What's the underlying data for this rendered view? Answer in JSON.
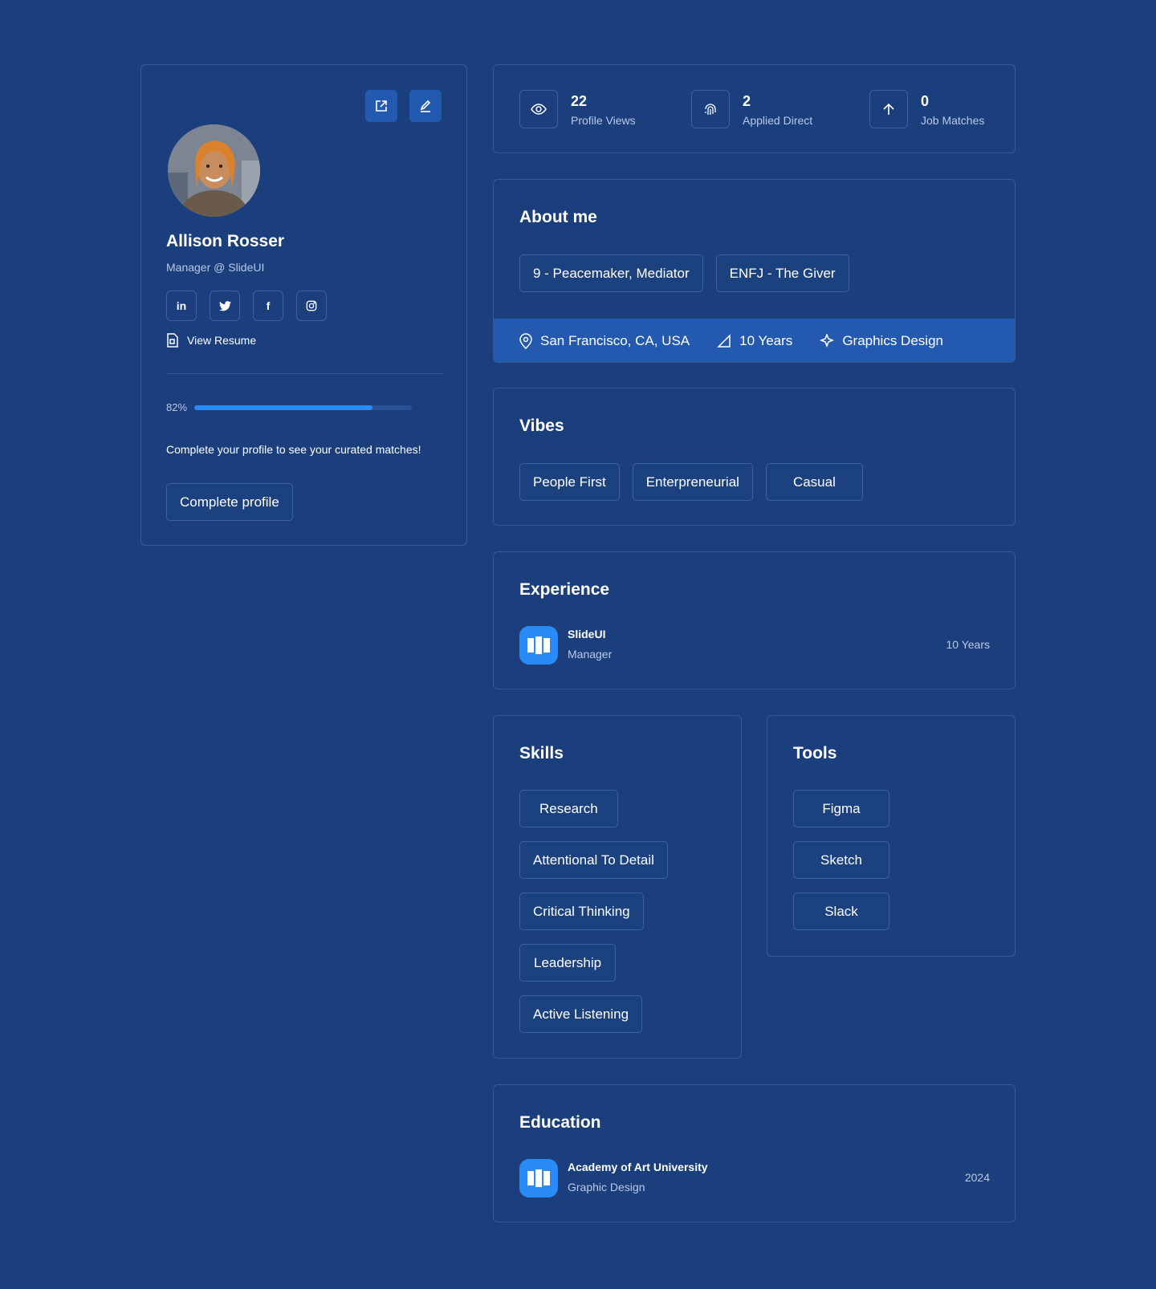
{
  "profile": {
    "name": "Allison Rosser",
    "title": "Manager @ SlideUI",
    "social": [
      {
        "icon": "linkedin-icon",
        "glyph": "in"
      },
      {
        "icon": "twitter-icon",
        "glyph": "t"
      },
      {
        "icon": "facebook-icon",
        "glyph": "f"
      },
      {
        "icon": "instagram-icon",
        "glyph": "ig"
      }
    ],
    "view_resume": "View Resume",
    "progress_label": "82%",
    "progress_value": 0.82,
    "prompt": "Complete your profile to see your curated matches!",
    "complete_button": "Complete profile"
  },
  "stats": [
    {
      "value": "22",
      "label": "Profile Views",
      "icon": "eye-icon"
    },
    {
      "value": "2",
      "label": "Applied Direct",
      "icon": "fingerprint-icon"
    },
    {
      "value": "0",
      "label": "Job Matches",
      "icon": "arrow-up-icon"
    }
  ],
  "about": {
    "title": "About me",
    "tags": [
      "9 - Peacemaker, Mediator",
      "ENFJ - The Giver"
    ],
    "location": "San Francisco, CA, USA",
    "experience": "10 Years",
    "field": "Graphics Design"
  },
  "vibes": {
    "title": "Vibes",
    "tags": [
      "People First",
      "Enterpreneurial",
      "Casual"
    ]
  },
  "experience": {
    "title": "Experience",
    "company": "SlideUI",
    "role": "Manager",
    "duration": "10 Years"
  },
  "skills": {
    "title": "Skills",
    "items": [
      "Research",
      "Attentional To Detail",
      "Critical Thinking",
      "Leadership",
      "Active Listening"
    ]
  },
  "tools": {
    "title": "Tools",
    "items": [
      "Figma",
      "Sketch",
      "Slack"
    ]
  },
  "education": {
    "title": "Education",
    "school": "Academy of Art University",
    "degree": "Graphic Design",
    "year": "2024"
  },
  "colors": {
    "background": "#1b3f7c",
    "accent": "#2a8af6",
    "highlight_bar": "#2459b0",
    "muted_text": "#b9c9e8"
  }
}
